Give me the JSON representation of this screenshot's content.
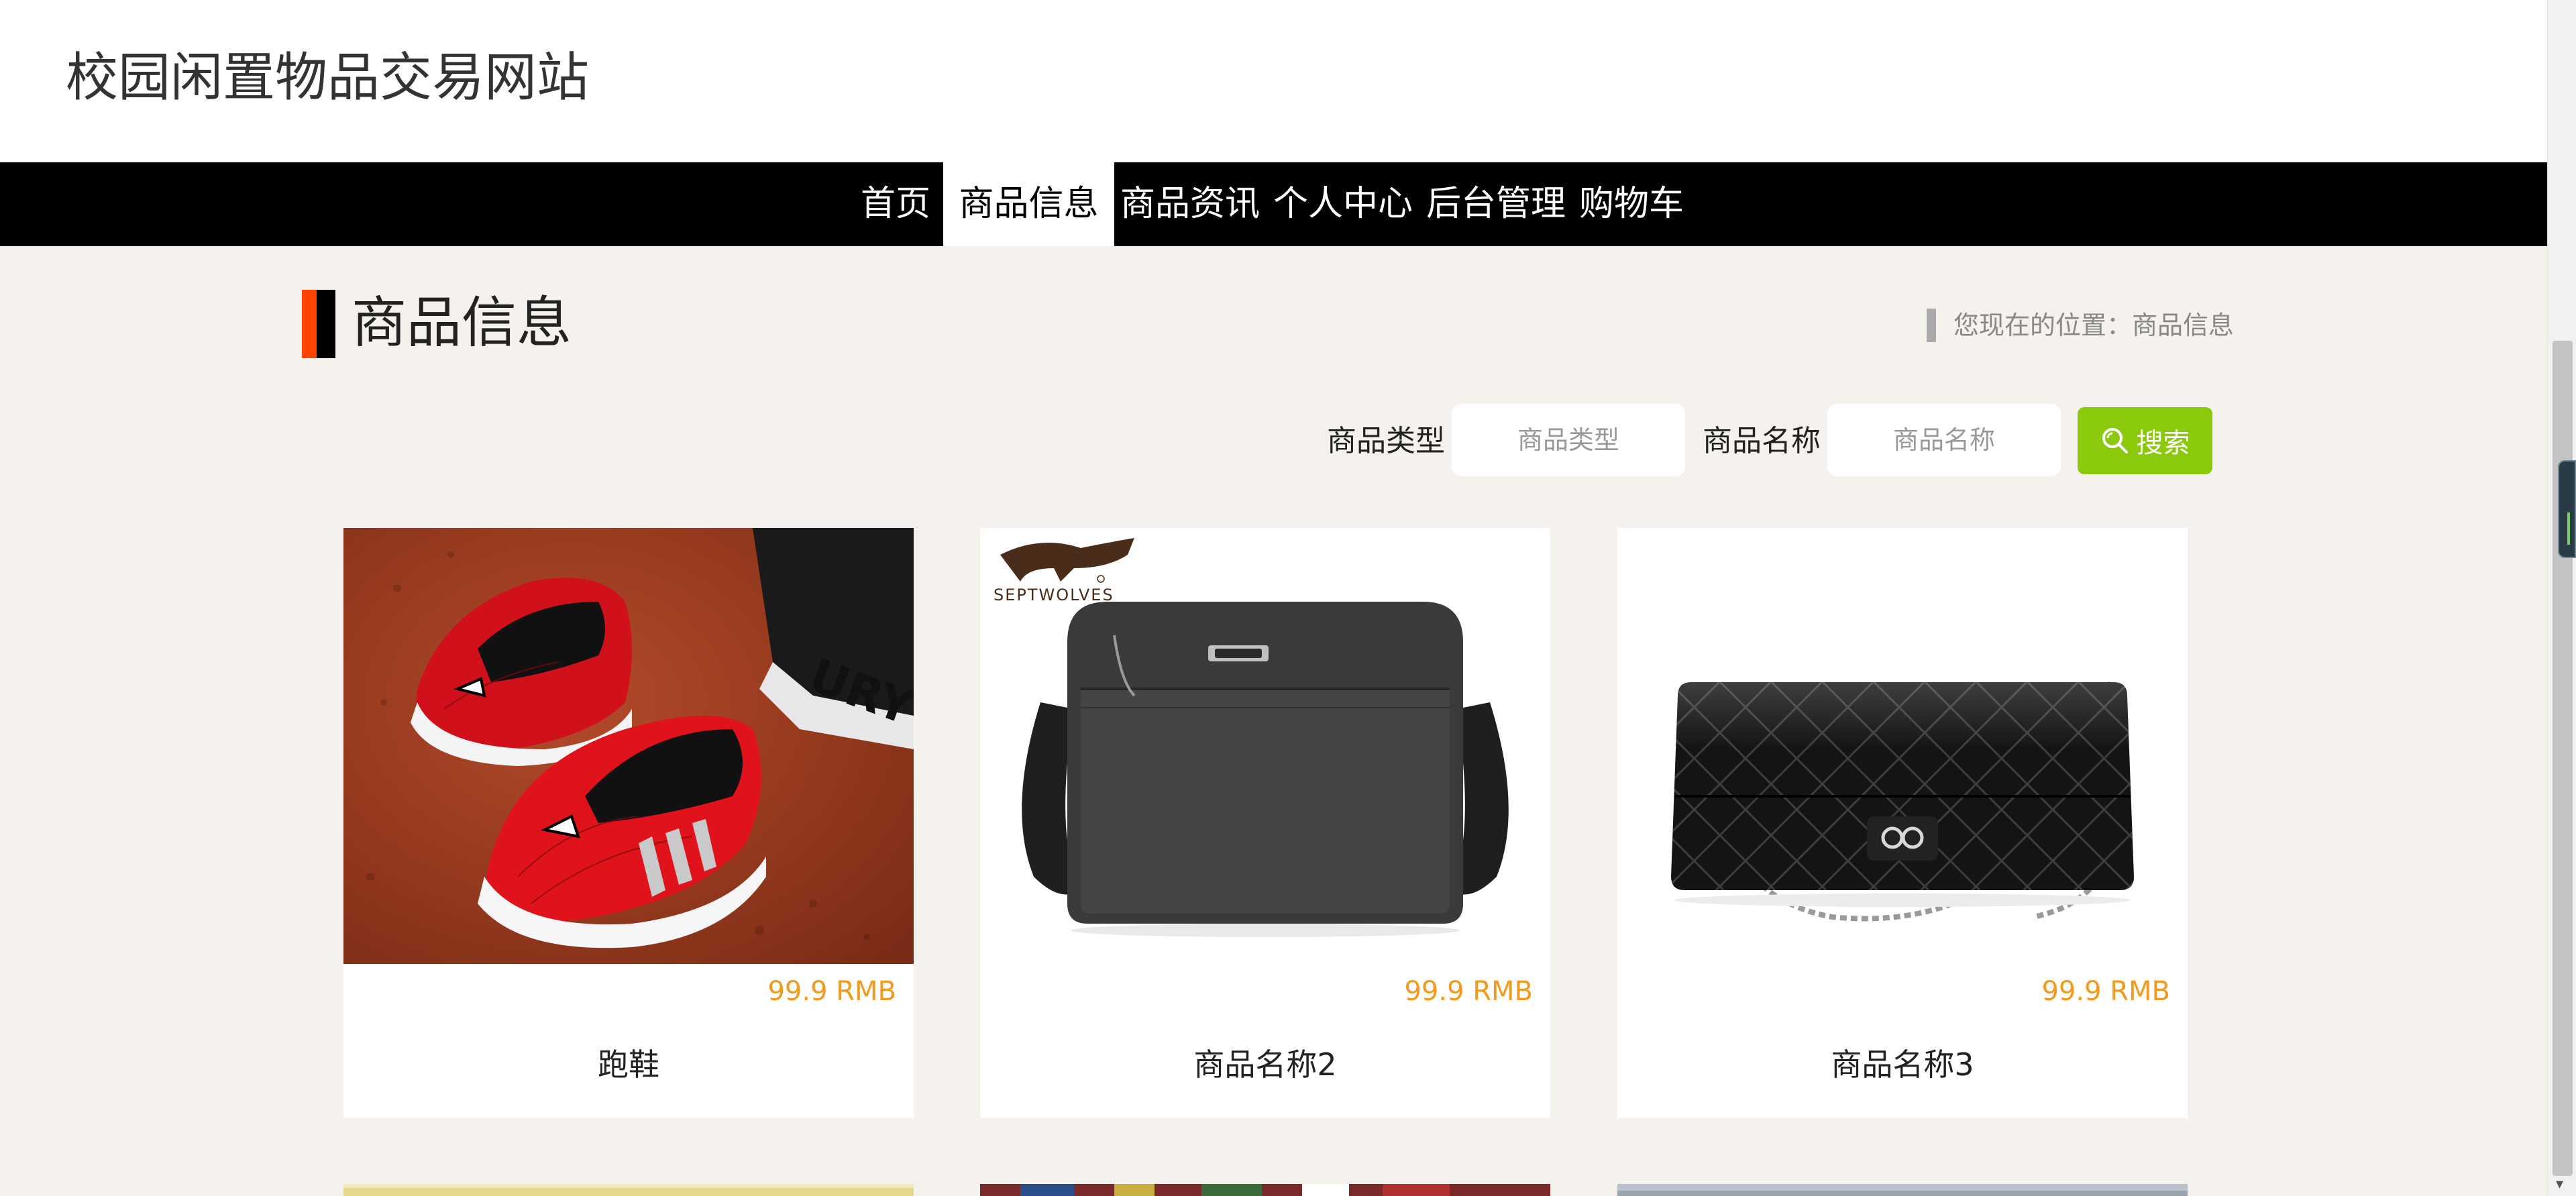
{
  "site": {
    "title": "校园闲置物品交易网站"
  },
  "nav": {
    "items": [
      {
        "label": "首页",
        "active": false
      },
      {
        "label": "商品信息",
        "active": true
      },
      {
        "label": "商品资讯",
        "active": false
      },
      {
        "label": "个人中心",
        "active": false
      },
      {
        "label": "后台管理",
        "active": false
      },
      {
        "label": "购物车",
        "active": false
      }
    ]
  },
  "section": {
    "title": "商品信息",
    "breadcrumb": "您现在的位置：商品信息"
  },
  "search": {
    "type_label": "商品类型",
    "type_placeholder": "商品类型",
    "name_label": "商品名称",
    "name_placeholder": "商品名称",
    "button_label": "搜索",
    "button_icon": "search-icon"
  },
  "products": [
    {
      "name": "跑鞋",
      "price": "99.9 RMB",
      "image": "red-spiderman-sneakers"
    },
    {
      "name": "商品名称2",
      "price": "99.9 RMB",
      "image": "septwolves-shoulder-bag",
      "brand": "SEPTWOLVES"
    },
    {
      "name": "商品名称3",
      "price": "99.9 RMB",
      "image": "black-quilted-chain-handbag"
    }
  ],
  "colors": {
    "accent_orange": "#ff4500",
    "price_orange": "#f39a1e",
    "search_green": "#8ac90c",
    "nav_black": "#000000",
    "page_bg": "#f5f1ed"
  }
}
